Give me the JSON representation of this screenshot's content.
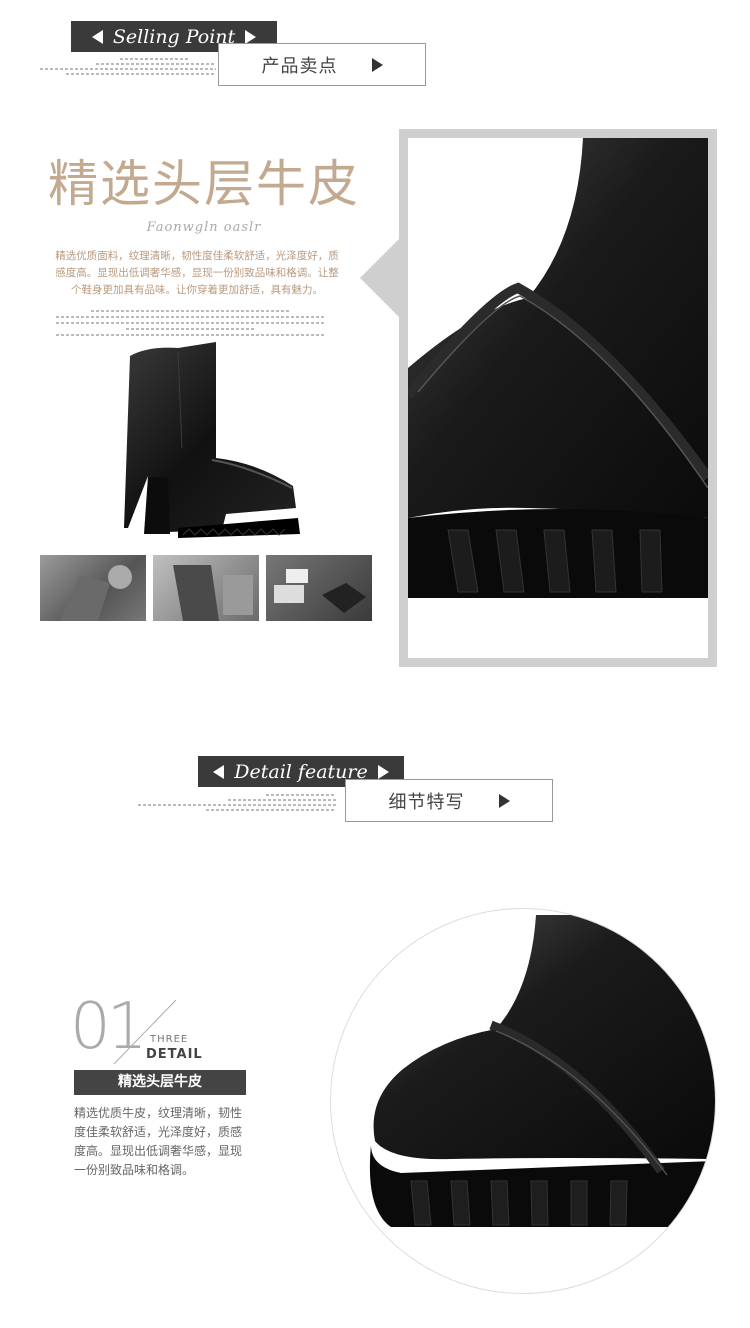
{
  "section1": {
    "banner_en": "Selling Point",
    "banner_cn": "产品卖点"
  },
  "feature": {
    "title": "精选头层牛皮",
    "subtitle_en": "Faonwgln oaslr",
    "description": "精选优质面料，纹理清晰，韧性度佳柔软舒适，光泽度好，质感度高。显现出低调奢华感，显现一份别致品味和格调。让整个鞋身更加具有品味。让你穿着更加舒适，具有魅力。"
  },
  "section2": {
    "banner_en": "Detail feature",
    "banner_cn": "细节特写"
  },
  "detail": {
    "number": "01",
    "label_small": "THREE",
    "label_big": "DETAIL",
    "tag": "精选头层牛皮",
    "description": "精选优质牛皮，纹理清晰，韧性度佳柔软舒适，光泽度好，质感度高。显现出低调奢华感，显现一份别致品味和格调。"
  },
  "colors": {
    "banner_dark": "#3a3a3a",
    "title_tan": "#c2a98f",
    "frame_gray": "#cfcfcf",
    "boot_black": "#141414"
  }
}
